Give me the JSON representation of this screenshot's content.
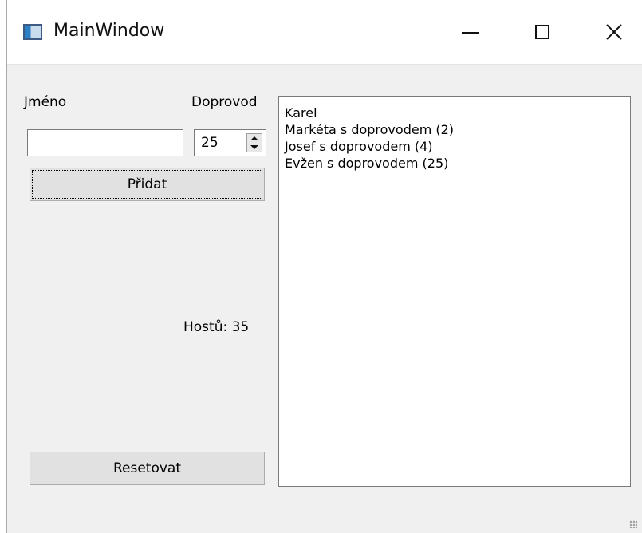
{
  "window": {
    "title": "MainWindow",
    "icon": "app-window-icon",
    "controls": [
      "minimize-icon",
      "maximize-icon",
      "close-icon"
    ]
  },
  "form": {
    "name_label": "Jméno",
    "name_value": "",
    "escort_label": "Doprovod",
    "escort_value": "25",
    "add_button": "Přidat",
    "reset_button": "Resetovat",
    "guests_count": "Hostů: 35"
  },
  "guests": [
    "Karel",
    "Markéta s doprovodem (2)",
    "Josef s doprovodem (4)",
    "Evžen s doprovodem (25)"
  ],
  "colors": {
    "window_bg": "#f0f0f0",
    "titlebar_bg": "#ffffff",
    "button_bg": "#e1e1e1",
    "border": "#7a7a7a"
  }
}
